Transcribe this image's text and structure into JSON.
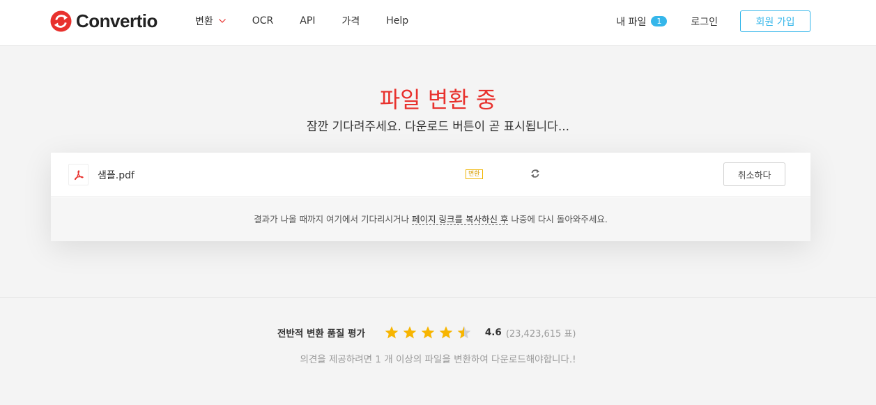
{
  "brand": {
    "name": "Convertio",
    "accent": "#e8312d",
    "link_color": "#35b6ea"
  },
  "nav": {
    "convert_label": "변환",
    "ocr_label": "OCR",
    "api_label": "API",
    "pricing_label": "가격",
    "help_label": "Help"
  },
  "account": {
    "my_files_label": "내 파일",
    "my_files_count": "1",
    "login_label": "로그인",
    "signup_label": "회원 가입"
  },
  "hero": {
    "title": "파일 변환 중",
    "subtitle": "잠깐 기다려주세요. 다운로드 버튼이 곧 표시됩니다..."
  },
  "file": {
    "name": "샘플.pdf",
    "icon": "pdf-icon",
    "status": "변환",
    "cancel_label": "취소하다"
  },
  "info": {
    "before": "결과가 나올 때까지 여기에서 기다리시거나 ",
    "link": "페이지 링크를 복사하신 후",
    "after": " 나중에 다시 돌아와주세요."
  },
  "rating": {
    "label": "전반적 변환 품질 평가",
    "stars": 4.6,
    "score": "4.6",
    "votes": "(23,423,615 표)",
    "note": "의견을 제공하려면 1 개 이상의 파일을 변환하여 다운로드해야합니다.!"
  }
}
